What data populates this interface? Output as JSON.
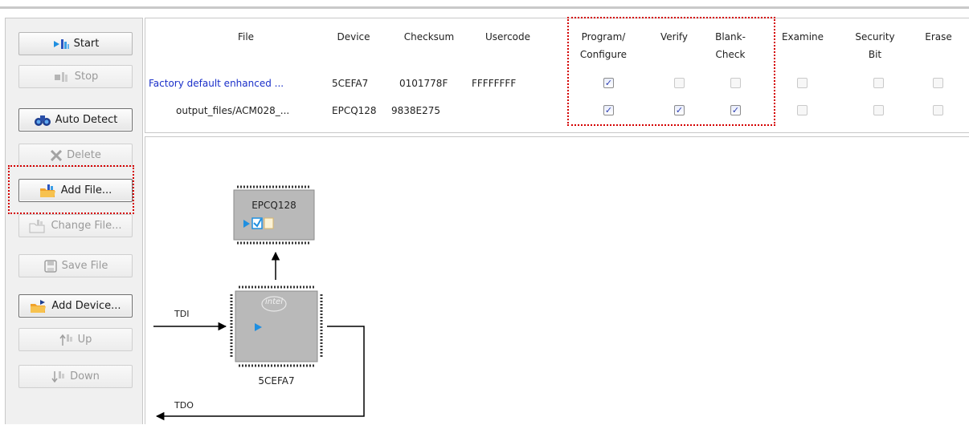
{
  "toolbar": {
    "buttons": [
      {
        "label": "Start",
        "icon": "start-icon",
        "enabled": true
      },
      {
        "label": "Stop",
        "icon": "stop-icon",
        "enabled": false
      },
      {
        "label": "Auto Detect",
        "icon": "auto-detect-icon",
        "enabled": true
      },
      {
        "label": "Delete",
        "icon": "delete-icon",
        "enabled": false
      },
      {
        "label": "Add File...",
        "icon": "add-file-icon",
        "enabled": true
      },
      {
        "label": "Change File...",
        "icon": "change-file-icon",
        "enabled": false
      },
      {
        "label": "Save File",
        "icon": "save-file-icon",
        "enabled": false
      },
      {
        "label": "Add Device...",
        "icon": "add-device-icon",
        "enabled": true
      },
      {
        "label": "Up",
        "icon": "up-icon",
        "enabled": false
      },
      {
        "label": "Down",
        "icon": "down-icon",
        "enabled": false
      }
    ]
  },
  "table": {
    "headers": {
      "file": "File",
      "device": "Device",
      "checksum": "Checksum",
      "usercode": "Usercode",
      "program_line1": "Program/",
      "program_line2": "Configure",
      "verify": "Verify",
      "blank_line1": "Blank-",
      "blank_line2": "Check",
      "examine": "Examine",
      "security_line1": "Security",
      "security_line2": "Bit",
      "erase": "Erase"
    },
    "rows": [
      {
        "file": "Factory default enhanced ...",
        "device": "5CEFA7",
        "checksum": "0101778F",
        "usercode": "FFFFFFFF",
        "program": true,
        "verify": false,
        "blank_check": false,
        "examine": false,
        "security_bit": false,
        "erase": false
      },
      {
        "file": "output_files/ACM028_...",
        "device": "EPCQ128",
        "checksum": "9838E275",
        "usercode": "",
        "program": true,
        "verify": true,
        "blank_check": true,
        "examine": false,
        "security_bit": false,
        "erase": false
      }
    ]
  },
  "diagram": {
    "flash_device": "EPCQ128",
    "fpga_device": "5CEFA7",
    "chip_logo": "intel",
    "tdi_label": "TDI",
    "tdo_label": "TDO"
  },
  "colors": {
    "highlight_border": "#d40000",
    "file_link": "#1a2fc9",
    "chip_fill": "#b9b9b9",
    "arrow_blue": "#1f8fe0"
  }
}
